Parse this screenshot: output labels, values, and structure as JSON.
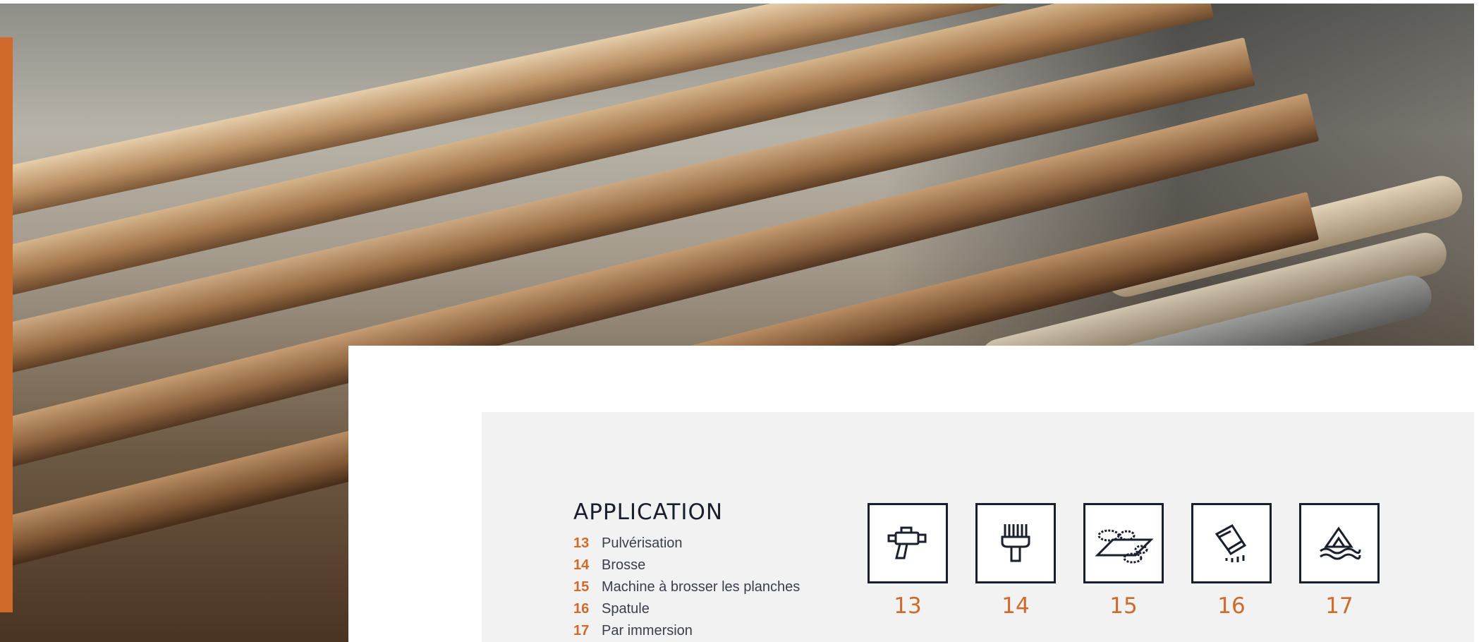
{
  "application": {
    "title": "APPLICATION",
    "items": [
      {
        "number": "13",
        "label": "Pulvérisation"
      },
      {
        "number": "14",
        "label": "Brosse"
      },
      {
        "number": "15",
        "label": "Machine à brosser les planches"
      },
      {
        "number": "16",
        "label": "Spatule"
      },
      {
        "number": "17",
        "label": "Par immersion"
      }
    ],
    "icons": [
      {
        "number": "13",
        "icon": "spray-gun-icon"
      },
      {
        "number": "14",
        "icon": "brush-icon"
      },
      {
        "number": "15",
        "icon": "board-brushing-machine-icon"
      },
      {
        "number": "16",
        "icon": "spatula-icon"
      },
      {
        "number": "17",
        "icon": "immersion-icon"
      }
    ]
  },
  "colors": {
    "accent": "#d06a2a",
    "navy": "#1a1f2e",
    "panel": "#f2f2f2"
  }
}
